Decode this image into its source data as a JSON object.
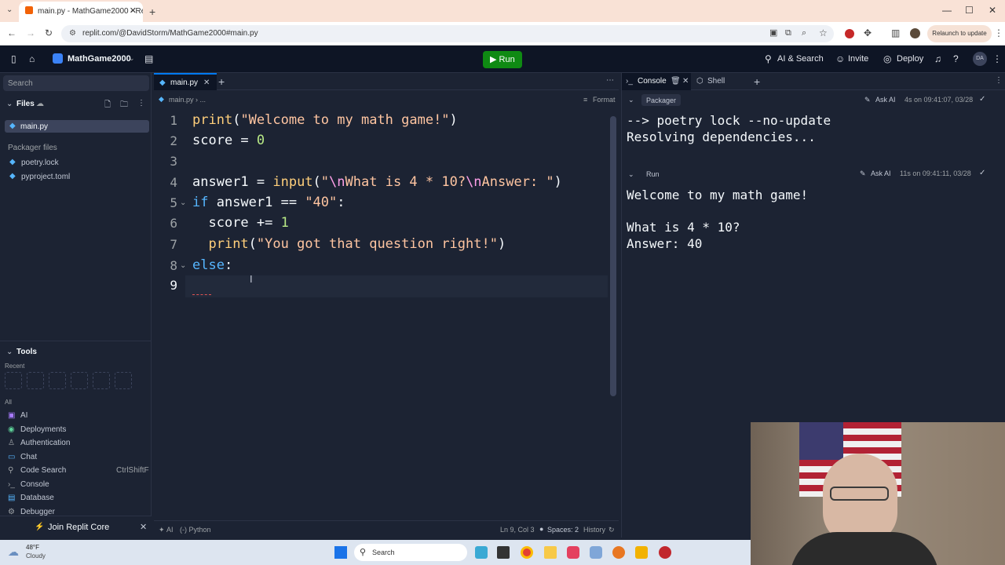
{
  "browser": {
    "tab_title": "main.py - MathGame2000 - Re",
    "url": "replit.com/@DavidStorm/MathGame2000#main.py",
    "relaunch_label": "Relaunch to update"
  },
  "topbar": {
    "project_name": "MathGame2000",
    "run_label": "Run",
    "ai_search_label": "AI & Search",
    "invite_label": "Invite",
    "deploy_label": "Deploy",
    "avatar_initials": "DA"
  },
  "sidebar": {
    "search_placeholder": "Search",
    "files_label": "Files",
    "active_file": "main.py",
    "packager_files_label": "Packager files",
    "packager_files": [
      "poetry.lock",
      "pyproject.toml"
    ],
    "tools_label": "Tools",
    "recent_label": "Recent",
    "all_label": "All",
    "tools": [
      {
        "label": "AI",
        "shortcut": ""
      },
      {
        "label": "Deployments",
        "shortcut": ""
      },
      {
        "label": "Authentication",
        "shortcut": ""
      },
      {
        "label": "Chat",
        "shortcut": ""
      },
      {
        "label": "Code Search",
        "shortcut": "CtrlShiftF"
      },
      {
        "label": "Console",
        "shortcut": ""
      },
      {
        "label": "Database",
        "shortcut": ""
      },
      {
        "label": "Debugger",
        "shortcut": ""
      }
    ],
    "join_label": "Join Replit Core"
  },
  "editor": {
    "tab_label": "main.py",
    "breadcrumb": "main.py  ›  ...",
    "format_label": "Format",
    "line_numbers": [
      "1",
      "2",
      "3",
      "4",
      "5",
      "6",
      "7",
      "8",
      "9"
    ],
    "status_ai": "AI",
    "status_lang": "(-) Python",
    "status_pos": "Ln 9, Col 3",
    "status_spaces": "Spaces: 2",
    "status_history": "History"
  },
  "console": {
    "tab_console": "Console",
    "tab_shell": "Shell",
    "packager_label": "Packager",
    "ask_ai": "Ask AI",
    "packager_time": "4s on 09:41:07, 03/28",
    "packager_output": [
      "--> poetry lock --no-update",
      "Resolving dependencies..."
    ],
    "run_label": "Run",
    "run_time": "11s on 09:41:11, 03/28",
    "run_output": [
      "Welcome to my math game!",
      "",
      "What is 4 * 10?",
      "Answer: 40"
    ]
  },
  "taskbar": {
    "weather_temp": "48°F",
    "weather_desc": "Cloudy",
    "search_label": "Search"
  },
  "colors": {
    "run_green": "#0f8a13",
    "editor_bg": "#1c2333",
    "topbar_bg": "#0e1525"
  }
}
